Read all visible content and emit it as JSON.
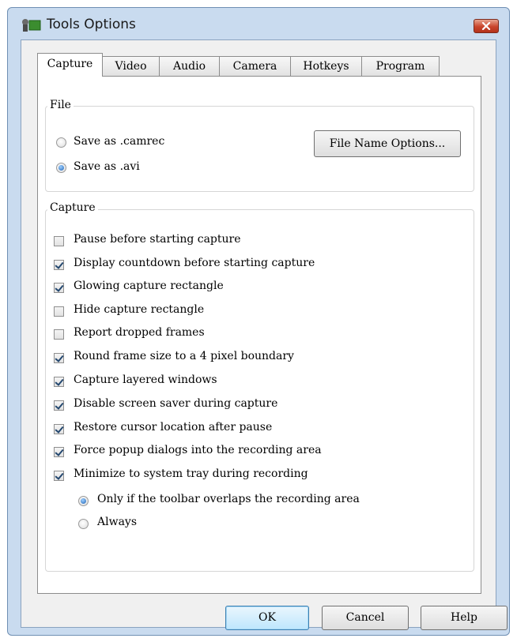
{
  "window": {
    "title": "Tools Options",
    "colors": {
      "highlight": "#e3001b",
      "frame": "#c9dbef",
      "close": "#c9452c"
    }
  },
  "tabs": [
    {
      "label": "Capture",
      "active": true
    },
    {
      "label": "Video"
    },
    {
      "label": "Audio"
    },
    {
      "label": "Camera"
    },
    {
      "label": "Hotkeys"
    },
    {
      "label": "Program"
    }
  ],
  "file_group": {
    "label": "File",
    "options": [
      {
        "label": "Save as .camrec",
        "selected": false
      },
      {
        "label": "Save as .avi",
        "selected": true
      }
    ],
    "file_name_options_label": "File Name Options..."
  },
  "capture_group": {
    "label": "Capture",
    "options": [
      {
        "label": "Pause before starting capture",
        "checked": false
      },
      {
        "label": "Display countdown before starting capture",
        "checked": true
      },
      {
        "label": "Glowing capture rectangle",
        "checked": true
      },
      {
        "label": "Hide capture rectangle",
        "checked": false
      },
      {
        "label": "Report dropped frames",
        "checked": false
      },
      {
        "label": "Round frame size to a 4 pixel boundary",
        "checked": true
      },
      {
        "label": "Capture layered windows",
        "checked": true
      },
      {
        "label": "Disable screen saver during capture",
        "checked": true
      },
      {
        "label": "Restore cursor location after pause",
        "checked": true
      },
      {
        "label": "Force popup dialogs into the recording area",
        "checked": true
      },
      {
        "label": "Minimize to system tray during recording",
        "checked": true
      }
    ],
    "tray_options": [
      {
        "label": "Only if the toolbar overlaps the recording area",
        "selected": true
      },
      {
        "label": "Always",
        "selected": false
      }
    ]
  },
  "buttons": {
    "ok": "OK",
    "cancel": "Cancel",
    "help": "Help"
  }
}
